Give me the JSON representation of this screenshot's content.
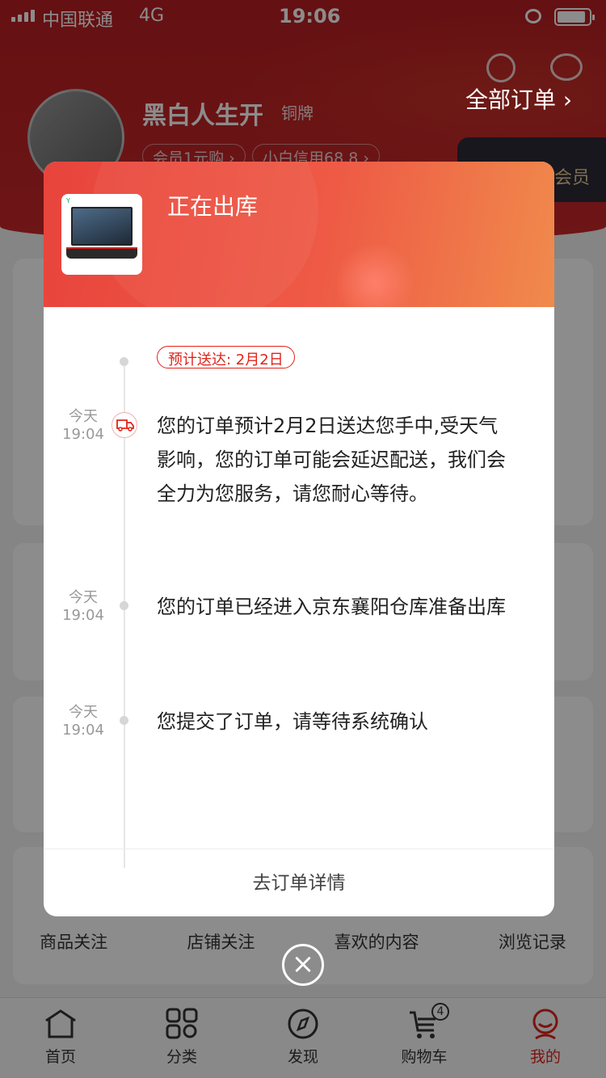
{
  "status_bar": {
    "carrier": "中国联通",
    "network": "4G",
    "time": "19:06"
  },
  "profile": {
    "username": "黑白人生开",
    "level": "铜牌",
    "member_pill": "会员1元购 ›",
    "credit_pill": "小白信用68.8 ›",
    "vip_label": "会员",
    "all_orders": "全部订单 ›"
  },
  "quick_links": [
    "商品关注",
    "店铺关注",
    "喜欢的内容",
    "浏览记录"
  ],
  "tabbar": [
    {
      "label": "首页",
      "icon": "home-icon"
    },
    {
      "label": "分类",
      "icon": "category-icon"
    },
    {
      "label": "发现",
      "icon": "discover-icon"
    },
    {
      "label": "购物车",
      "icon": "cart-icon",
      "badge": "4"
    },
    {
      "label": "我的",
      "icon": "profile-icon",
      "active": true
    }
  ],
  "modal": {
    "title": "正在出库",
    "eta": "预计送达: 2月2日",
    "events": [
      {
        "day": "今天",
        "time": "19:04",
        "text": "您的订单预计2月2日送达您手中,受天气影响，您的订单可能会延迟配送，我们会全力为您服务，请您耐心等待。"
      },
      {
        "day": "今天",
        "time": "19:04",
        "text": "您的订单已经进入京东襄阳仓库准备出库"
      },
      {
        "day": "今天",
        "time": "19:04",
        "text": "您提交了订单，请等待系统确认"
      }
    ],
    "footer": "去订单详情",
    "close_symbol": "×"
  },
  "colors": {
    "accent": "#e2231a",
    "header_red": "#c8282a"
  }
}
